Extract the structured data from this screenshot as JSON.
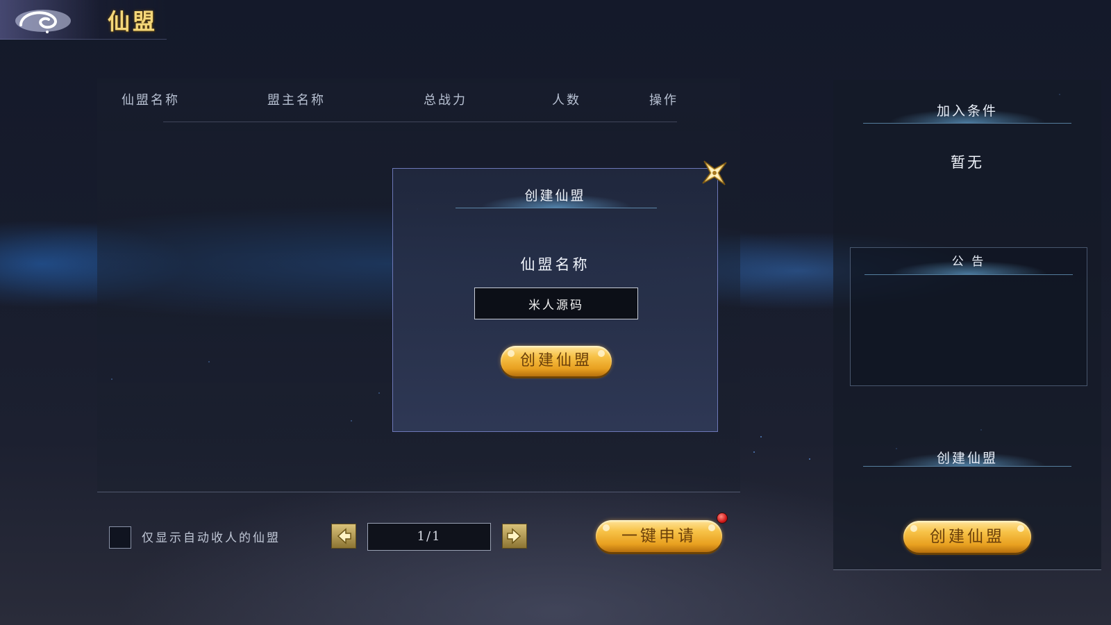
{
  "header": {
    "title": "仙盟"
  },
  "table": {
    "columns": [
      "仙盟名称",
      "盟主名称",
      "总战力",
      "人数",
      "操作"
    ],
    "rows": []
  },
  "modal": {
    "title": "创建仙盟",
    "name_label": "仙盟名称",
    "name_value": "米人源码",
    "submit_label": "创建仙盟"
  },
  "footer": {
    "checkbox_label": "仅显示自动收人的仙盟",
    "checkbox_checked": false,
    "page_indicator": "1/1",
    "apply_all_label": "一键申请"
  },
  "right_panel": {
    "join_title": "加入条件",
    "join_value": "暂无",
    "notice_title": "公 告",
    "notice_text": "",
    "create_title": "创建仙盟",
    "create_button_label": "创建仙盟"
  },
  "colors": {
    "gold": "#f7c247",
    "button_text": "#6a3f0a",
    "modal_border": "#6d78b8",
    "notification": "#d11a1a"
  },
  "icons": [
    "cloud-swirl-icon",
    "close-icon",
    "arrow-left-icon",
    "arrow-right-icon",
    "notification-dot-icon"
  ]
}
